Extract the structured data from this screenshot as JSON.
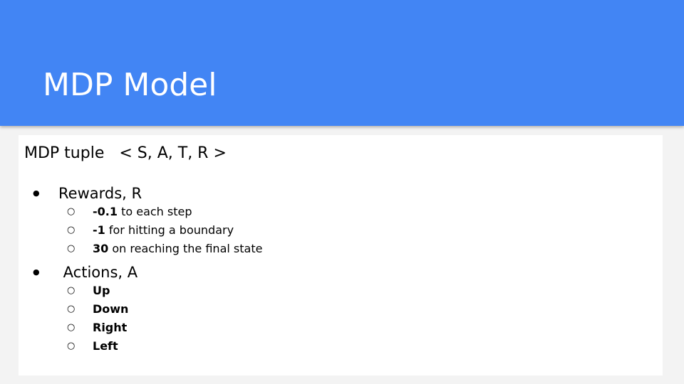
{
  "slide": {
    "title": "MDP Model",
    "intro": "MDP tuple   < S, A, T, R >"
  },
  "sections": [
    {
      "bullet": "●",
      "heading": "Rewards, R",
      "items": [
        {
          "marker": "○",
          "bold": "-0.1",
          "text": " to each step"
        },
        {
          "marker": "○",
          "bold": "-1",
          "text": " for hitting a boundary"
        },
        {
          "marker": "○",
          "bold": "30",
          "text": " on reaching the final state"
        }
      ]
    },
    {
      "bullet": "●",
      "heading": " Actions, A",
      "items": [
        {
          "marker": "○",
          "bold": "Up",
          "text": ""
        },
        {
          "marker": "○",
          "bold": "Down",
          "text": ""
        },
        {
          "marker": "○",
          "bold": "Right",
          "text": ""
        },
        {
          "marker": "○",
          "bold": "Left",
          "text": ""
        }
      ]
    }
  ],
  "colors": {
    "header_bg": "#4285f4",
    "page_bg": "#f3f3f3",
    "panel_bg": "#ffffff",
    "title_text": "#ffffff",
    "body_text": "#000000"
  }
}
